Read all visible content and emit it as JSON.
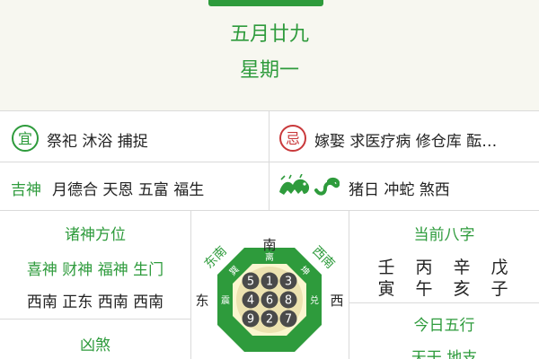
{
  "header": {
    "lunar_date": "五月廿九",
    "weekday": "星期一"
  },
  "yi": {
    "badge": "宜",
    "text": "祭祀 沐浴 捕捉"
  },
  "ji": {
    "badge": "忌",
    "text": "嫁娶 求医疗病 修仓库 酝…"
  },
  "shen": {
    "label": "吉神",
    "text": "月德合 天恩 五富 福生"
  },
  "zodiac": {
    "icon_left": "dragon-icon",
    "icon_right": "snake-icon",
    "text": "猪日 冲蛇 煞西"
  },
  "gods_direction": {
    "title": "诸神方位",
    "names": "喜神 财神 福神 生门",
    "directions": "西南 正东 西南 西南"
  },
  "xiongsha": {
    "title": "凶煞"
  },
  "compass": {
    "south": "南",
    "east": "东",
    "west": "西",
    "southeast": "东南",
    "southwest": "西南",
    "trigram_south": "离",
    "trigram_southeast": "巽",
    "trigram_southwest": "坤",
    "trigram_east": "震",
    "trigram_west": "兑",
    "numbers": [
      "5",
      "1",
      "3",
      "4",
      "6",
      "8",
      "9",
      "2",
      "7"
    ]
  },
  "bazi": {
    "title": "当前八字",
    "stems": [
      "壬",
      "丙",
      "辛",
      "戊"
    ],
    "branches": [
      "寅",
      "午",
      "亥",
      "子"
    ]
  },
  "wuxing": {
    "title": "今日五行",
    "sub": "天干 地支"
  },
  "colors": {
    "green": "#2e9b3c",
    "red": "#c9393b",
    "background": "#f7f7f0"
  }
}
